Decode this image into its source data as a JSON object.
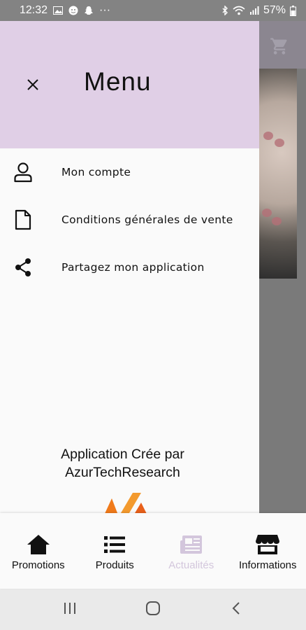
{
  "status_bar": {
    "time": "12:32",
    "dots": "···",
    "battery": "57%",
    "icons": [
      "image-icon",
      "face-icon",
      "snapchat-icon",
      "bluetooth-icon",
      "wifi-icon",
      "signal-icon",
      "battery-icon"
    ]
  },
  "drawer": {
    "title": "Menu",
    "close_icon": "close-icon",
    "items": [
      {
        "label": "Mon compte",
        "icon": "user-icon"
      },
      {
        "label": "Conditions générales de vente",
        "icon": "document-icon"
      },
      {
        "label": "Partagez mon application",
        "icon": "share-icon"
      }
    ],
    "credit_line1": "Application Crée par",
    "credit_line2": "AzurTechResearch"
  },
  "bottom_nav": {
    "items": [
      {
        "label": "Promotions",
        "icon": "home-icon",
        "active": true
      },
      {
        "label": "Produits",
        "icon": "list-icon",
        "active": true
      },
      {
        "label": "Actualités",
        "icon": "newspaper-icon",
        "active": false
      },
      {
        "label": "Informations",
        "icon": "store-icon",
        "active": true
      }
    ]
  },
  "system_nav": {
    "buttons": [
      "recent-apps-icon",
      "home-circle-icon",
      "back-icon"
    ]
  },
  "colors": {
    "drawer_header": "#e0cfe6",
    "inactive_nav": "#d3c6dc",
    "status_bar": "#838383",
    "logo_orange": "#f07a1a"
  }
}
